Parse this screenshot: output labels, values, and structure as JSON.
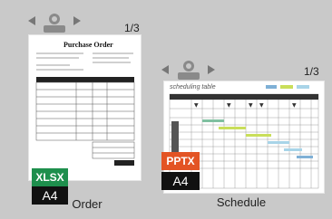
{
  "cards": [
    {
      "name": "Order",
      "file_type": "XLSX",
      "paper_size": "A4",
      "page_counter": "1/3",
      "doc_title": "Purchase Order",
      "type_color": "#1e8f4d"
    },
    {
      "name": "Schedule",
      "file_type": "PPTX",
      "paper_size": "A4",
      "page_counter": "1/3",
      "doc_title": "scheduling table",
      "type_color": "#e35424"
    }
  ],
  "icons": {
    "prev": "triangle-left-icon",
    "next": "triangle-right-icon",
    "clip": "binder-clip-icon"
  }
}
